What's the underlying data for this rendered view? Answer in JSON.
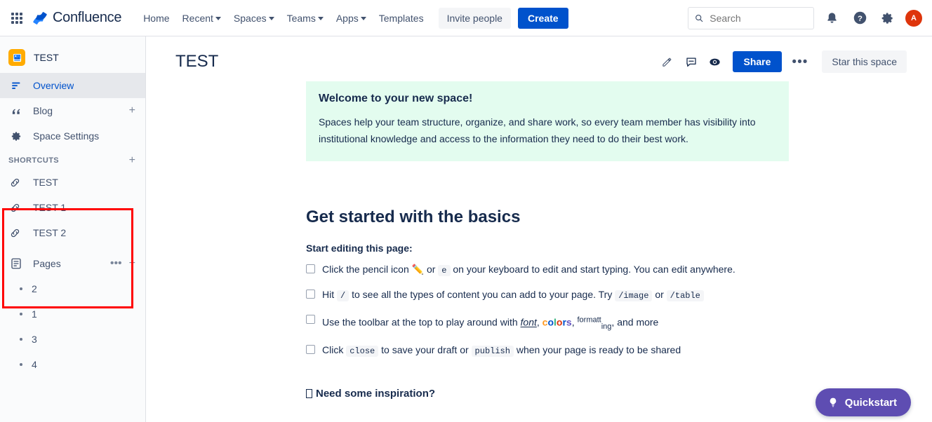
{
  "topnav": {
    "app_switcher": "app-switcher",
    "brand": "Confluence",
    "items": [
      {
        "label": "Home",
        "has_caret": false
      },
      {
        "label": "Recent",
        "has_caret": true
      },
      {
        "label": "Spaces",
        "has_caret": true
      },
      {
        "label": "Teams",
        "has_caret": true
      },
      {
        "label": "Apps",
        "has_caret": true
      },
      {
        "label": "Templates",
        "has_caret": false
      }
    ],
    "invite_label": "Invite people",
    "create_label": "Create",
    "search_placeholder": "Search",
    "avatar_initial": "A"
  },
  "sidebar": {
    "space_name": "TEST",
    "nav": [
      {
        "label": "Overview",
        "icon": "overview-icon",
        "active": true,
        "has_add": false
      },
      {
        "label": "Blog",
        "icon": "quote-icon",
        "active": false,
        "has_add": true
      },
      {
        "label": "Space Settings",
        "icon": "gear-icon",
        "active": false,
        "has_add": false
      }
    ],
    "shortcuts_title": "SHORTCUTS",
    "shortcuts": [
      {
        "label": "TEST"
      },
      {
        "label": "TEST 1"
      },
      {
        "label": "TEST 2"
      }
    ],
    "pages_title": "Pages",
    "pages": [
      {
        "label": "2"
      },
      {
        "label": "1"
      },
      {
        "label": "3"
      },
      {
        "label": "4"
      }
    ],
    "annotation_color": "#FF0000"
  },
  "content": {
    "page_title": "TEST",
    "actions": {
      "edit_icon": "pencil-icon",
      "comment_icon": "comment-icon",
      "watch_icon": "eye-icon",
      "share_label": "Share",
      "more_label": "•••",
      "star_label": "Star this space"
    },
    "welcome": {
      "title": "Welcome to your new space!",
      "body": "Spaces help your team structure, organize, and share work, so every team member has visibility into institutional knowledge and access to the information they need to do their best work.",
      "background": "#E3FCEF"
    },
    "heading": "Get started with the basics",
    "subheading": "Start editing this page:",
    "checklist": [
      {
        "parts": [
          {
            "t": "text",
            "v": "Click the pencil icon "
          },
          {
            "t": "emoji",
            "v": "✏️"
          },
          {
            "t": "text",
            "v": " or "
          },
          {
            "t": "code",
            "v": "e"
          },
          {
            "t": "text",
            "v": " on your keyboard to edit and start typing. You can edit anywhere."
          }
        ]
      },
      {
        "parts": [
          {
            "t": "text",
            "v": "Hit "
          },
          {
            "t": "code",
            "v": "/"
          },
          {
            "t": "text",
            "v": " to see all the types of content you can add to your page. Try "
          },
          {
            "t": "code",
            "v": "/image"
          },
          {
            "t": "text",
            "v": " or "
          },
          {
            "t": "code",
            "v": "/table"
          }
        ]
      },
      {
        "parts": [
          {
            "t": "text",
            "v": "Use the toolbar at the top to play around with "
          },
          {
            "t": "underline",
            "v": "font"
          },
          {
            "t": "text",
            "v": ", "
          },
          {
            "t": "colors",
            "v": "colors"
          },
          {
            "t": "text",
            "v": ", "
          },
          {
            "t": "formatting",
            "v": "formatting"
          },
          {
            "t": "text",
            "v": ", and more"
          }
        ]
      },
      {
        "parts": [
          {
            "t": "text",
            "v": "Click "
          },
          {
            "t": "code",
            "v": "close"
          },
          {
            "t": "text",
            "v": " to save your draft or "
          },
          {
            "t": "code",
            "v": "publish"
          },
          {
            "t": "text",
            "v": " when your page is ready to be shared"
          }
        ]
      }
    ],
    "inspiration": "Need some inspiration?",
    "colors_letters": [
      {
        "ch": "c",
        "color": "#FF991F"
      },
      {
        "ch": "o",
        "color": "#0052CC"
      },
      {
        "ch": "l",
        "color": "#36B37E"
      },
      {
        "ch": "o",
        "color": "#DE350B"
      },
      {
        "ch": "r",
        "color": "#0052CC"
      },
      {
        "ch": "s",
        "color": "#6554C0"
      }
    ]
  },
  "quickstart": {
    "label": "Quickstart",
    "icon": "lightbulb-icon",
    "color": "#5E4DB2"
  }
}
